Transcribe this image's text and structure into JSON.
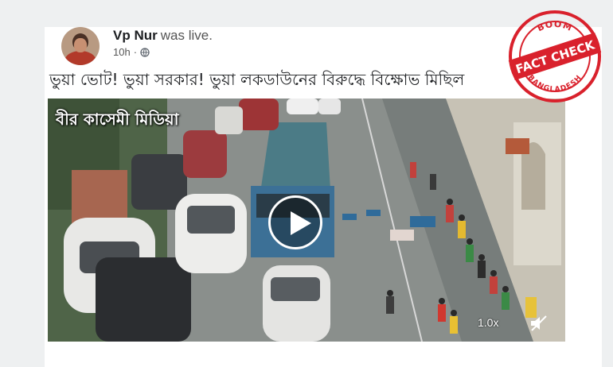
{
  "post": {
    "author": "Vp Nur",
    "author_suffix": "was live.",
    "time": "10h",
    "dot": "·",
    "privacy_icon": "globe-icon",
    "text": "ভুয়া ভোট! ভুয়া সরকার! ভুয়া লকডাউনের বিরুদ্ধে বিক্ষোভ মিছিল"
  },
  "video": {
    "watermark": "বীর কাসেমী মিডিয়া",
    "speed": "1.0x",
    "play_icon": "play-icon",
    "volume_icon": "volume-muted-icon"
  },
  "stamp": {
    "top": "BOOM",
    "middle": "FACT CHECK",
    "bottom": "BANGLADESH",
    "color": "#d9212c"
  }
}
